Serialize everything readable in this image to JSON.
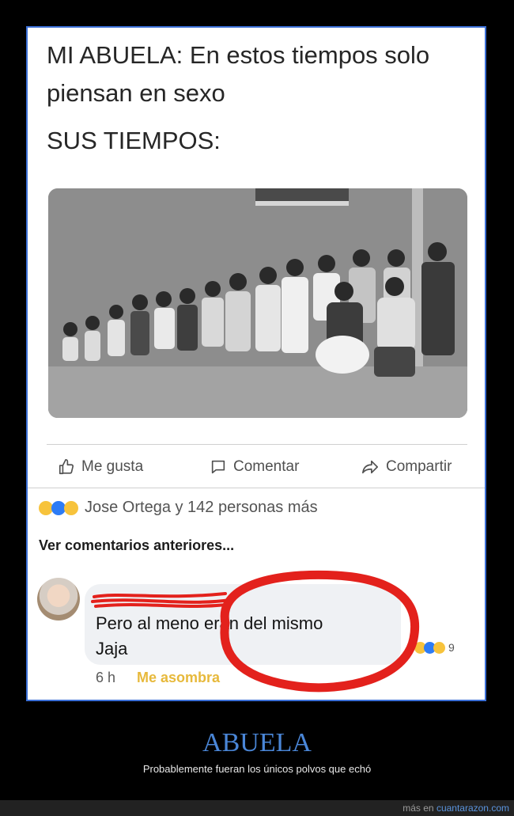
{
  "meme": {
    "caption_line1": "MI ABUELA: En estos tiempos solo",
    "caption_line2": "piensan en sexo",
    "caption_line3": "SUS TIEMPOS:"
  },
  "post_actions": {
    "like": "Me gusta",
    "comment": "Comentar",
    "share": "Compartir"
  },
  "reactions": {
    "summary": "Jose Ortega y 142 personas más",
    "icons": [
      "haha-icon",
      "like-icon",
      "wow-icon"
    ]
  },
  "comments": {
    "view_previous": "Ver comentarios anteriores...",
    "text_line1": "Pero al meno  eran del mismo",
    "text_line2": "Jaja",
    "reaction_count": "9",
    "time": "6 h",
    "reaction_label": "Me asombra"
  },
  "site": {
    "title": "ABUELA",
    "subtitle": "Probablemente fueran los únicos polvos que echó",
    "footer_prefix": "más en ",
    "footer_link": "cuantarazon.com"
  },
  "colors": {
    "frame_border": "#3b6fd6",
    "title": "#4a86d7",
    "reaction_label": "#e7b93b",
    "annotation": "#e3211c"
  }
}
